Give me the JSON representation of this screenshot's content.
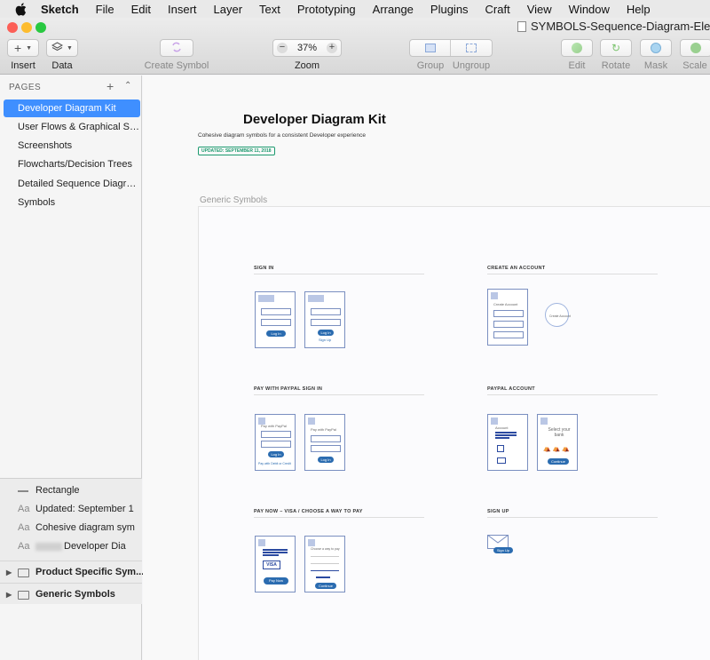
{
  "menubar": {
    "app": "Sketch",
    "items": [
      "File",
      "Edit",
      "Insert",
      "Layer",
      "Text",
      "Prototyping",
      "Arrange",
      "Plugins",
      "Craft",
      "View",
      "Window",
      "Help"
    ]
  },
  "window": {
    "title": "SYMBOLS-Sequence-Diagram-Element"
  },
  "toolbar": {
    "insert": "Insert",
    "data": "Data",
    "create_symbol": "Create Symbol",
    "zoom_value": "37%",
    "zoom": "Zoom",
    "group": "Group",
    "ungroup": "Ungroup",
    "edit": "Edit",
    "rotate": "Rotate",
    "mask": "Mask",
    "scale": "Scale",
    "minus": "−",
    "plus": "+",
    "plus_icon": "+"
  },
  "sidebar": {
    "pages_header": "PAGES",
    "pages": [
      "Developer Diagram Kit",
      "User Flows & Graphical Se...",
      "Screenshots",
      "Flowcharts/Decision Trees",
      "Detailed Sequence Diagrams",
      "Symbols"
    ],
    "layers": [
      {
        "icon": "rectangle-icon",
        "label": "Rectangle"
      },
      {
        "icon": "Aa",
        "label": "Updated: September 1"
      },
      {
        "icon": "Aa",
        "label": "Cohesive diagram sym"
      },
      {
        "icon": "Aa",
        "label": "Developer Dia"
      }
    ],
    "groups": [
      "Product Specific Sym...",
      "Generic Symbols"
    ]
  },
  "canvas": {
    "title": "Developer Diagram Kit",
    "subtitle": "Cohesive diagram symbols for a consistent Developer experience",
    "badge": "UPDATED: SEPTEMBER 11, 2018",
    "artboard_label": "Generic Symbols",
    "sections": [
      "SIGN IN",
      "CREATE AN ACCOUNT",
      "PAY WITH PAYPAL SIGN IN",
      "PAYPAL ACCOUNT",
      "PAY NOW – VISA / CHOOSE A WAY TO PAY",
      "SIGN UP"
    ],
    "mock": {
      "log_in": "Log In",
      "sign_up": "Sign Up",
      "create_account": "Create Account",
      "pay_with_paypal": "Pay with PayPal",
      "pay_debit": "Pay with Debit or Credit",
      "account": "Account",
      "select_bank": "Select your bank",
      "continue": "Continue",
      "visa": "VISA",
      "pay_now": "Pay Now",
      "choose_way": "Choose a way to pay"
    }
  },
  "colors": {
    "accent": "#3f8fff",
    "close": "#fc5f57",
    "min": "#fdbc2e",
    "max": "#28c840",
    "badge": "#1c9a6f"
  }
}
